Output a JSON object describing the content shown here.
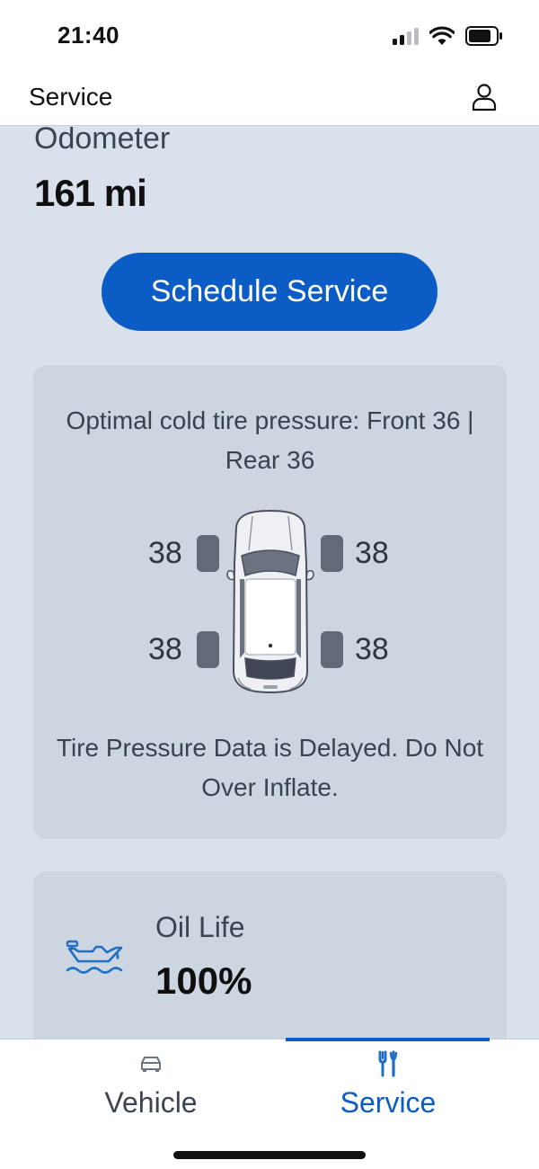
{
  "status_bar": {
    "time": "21:40",
    "icons": [
      "cellular-signal-icon",
      "wifi-icon",
      "battery-icon"
    ]
  },
  "header": {
    "title": "Service",
    "profile_icon": "person-icon"
  },
  "odometer": {
    "label": "Odometer",
    "value": "161 mi"
  },
  "schedule_button": {
    "label": "Schedule Service"
  },
  "tire_pressure": {
    "optimal_text": "Optimal cold tire pressure: Front 36 | Rear 36",
    "front_left": "38",
    "front_right": "38",
    "rear_left": "38",
    "rear_right": "38",
    "warning_text": "Tire Pressure Data is Delayed. Do Not Over Inflate."
  },
  "oil": {
    "label": "Oil Life",
    "value": "100%",
    "icon": "oil-can-icon"
  },
  "bottom_nav": {
    "tabs": [
      {
        "label": "Vehicle",
        "icon": "car-icon",
        "active": false
      },
      {
        "label": "Service",
        "icon": "tools-icon",
        "active": true
      }
    ]
  },
  "colors": {
    "accent": "#0b5cc4",
    "background": "#d9e1ec",
    "card": "#cdd5e1",
    "tire_indicator": "#626a78"
  }
}
